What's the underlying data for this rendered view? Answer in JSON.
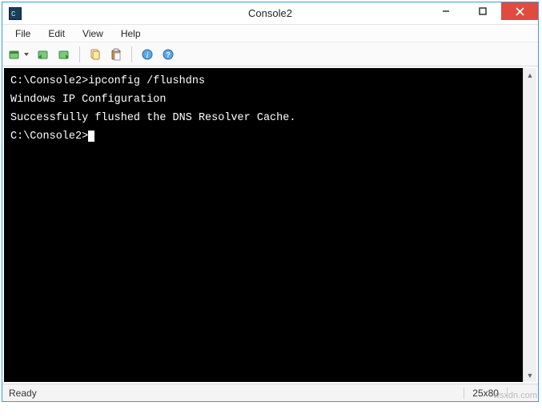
{
  "window": {
    "title": "Console2"
  },
  "menu": {
    "file": "File",
    "edit": "Edit",
    "view": "View",
    "help": "Help"
  },
  "terminal": {
    "line1_prompt": "C:\\Console2>",
    "line1_cmd": "ipconfig /flushdns",
    "blank1": "",
    "line2": "Windows IP Configuration",
    "blank2": "",
    "line3": "Successfully flushed the DNS Resolver Cache.",
    "blank3": "",
    "line4_prompt": "C:\\Console2>"
  },
  "status": {
    "left": "Ready",
    "size": "25x80"
  },
  "watermark": "wsxdn.com"
}
